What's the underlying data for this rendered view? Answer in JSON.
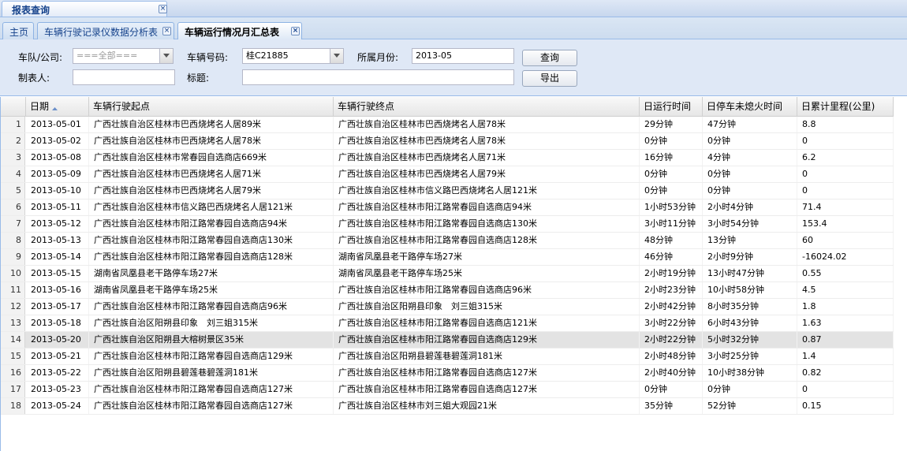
{
  "outer_tab": {
    "label": "报表查询"
  },
  "tabs": [
    {
      "label": "主页"
    },
    {
      "label": "车辆行驶记录仪数据分析表"
    },
    {
      "label": "车辆运行情况月汇总表"
    }
  ],
  "form": {
    "company_label": "车队/公司:",
    "company_value": "===全部===",
    "vehicle_label": "车辆号码:",
    "vehicle_value": "桂C21885",
    "month_label": "所属月份:",
    "month_value": "2013-05",
    "maker_label": "制表人:",
    "maker_value": "",
    "title_label": "标题:",
    "title_value": "",
    "query_button": "查询",
    "export_button": "导出"
  },
  "grid": {
    "columns": [
      "日期",
      "车辆行驶起点",
      "车辆行驶终点",
      "日运行时间",
      "日停车未熄火时间",
      "日累计里程(公里)"
    ],
    "rows": [
      {
        "n": "1",
        "date": "2013-05-01",
        "start": "广西壮族自治区桂林市巴西烧烤名人居89米",
        "end": "广西壮族自治区桂林市巴西烧烤名人居78米",
        "run": "29分钟",
        "idle": "47分钟",
        "km": "8.8"
      },
      {
        "n": "2",
        "date": "2013-05-02",
        "start": "广西壮族自治区桂林市巴西烧烤名人居78米",
        "end": "广西壮族自治区桂林市巴西烧烤名人居78米",
        "run": "0分钟",
        "idle": "0分钟",
        "km": "0"
      },
      {
        "n": "3",
        "date": "2013-05-08",
        "start": "广西壮族自治区桂林市常春园自选商店669米",
        "end": "广西壮族自治区桂林市巴西烧烤名人居71米",
        "run": "16分钟",
        "idle": "4分钟",
        "km": "6.2"
      },
      {
        "n": "4",
        "date": "2013-05-09",
        "start": "广西壮族自治区桂林市巴西烧烤名人居71米",
        "end": "广西壮族自治区桂林市巴西烧烤名人居79米",
        "run": "0分钟",
        "idle": "0分钟",
        "km": "0"
      },
      {
        "n": "5",
        "date": "2013-05-10",
        "start": "广西壮族自治区桂林市巴西烧烤名人居79米",
        "end": "广西壮族自治区桂林市信义路巴西烧烤名人居121米",
        "run": "0分钟",
        "idle": "0分钟",
        "km": "0"
      },
      {
        "n": "6",
        "date": "2013-05-11",
        "start": "广西壮族自治区桂林市信义路巴西烧烤名人居121米",
        "end": "广西壮族自治区桂林市阳江路常春园自选商店94米",
        "run": "1小时53分钟",
        "idle": "2小时4分钟",
        "km": "71.4"
      },
      {
        "n": "7",
        "date": "2013-05-12",
        "start": "广西壮族自治区桂林市阳江路常春园自选商店94米",
        "end": "广西壮族自治区桂林市阳江路常春园自选商店130米",
        "run": "3小时11分钟",
        "idle": "3小时54分钟",
        "km": "153.4"
      },
      {
        "n": "8",
        "date": "2013-05-13",
        "start": "广西壮族自治区桂林市阳江路常春园自选商店130米",
        "end": "广西壮族自治区桂林市阳江路常春园自选商店128米",
        "run": "48分钟",
        "idle": "13分钟",
        "km": "60"
      },
      {
        "n": "9",
        "date": "2013-05-14",
        "start": "广西壮族自治区桂林市阳江路常春园自选商店128米",
        "end": "湖南省凤凰县老干路停车场27米",
        "run": "46分钟",
        "idle": "2小时9分钟",
        "km": "-16024.02"
      },
      {
        "n": "10",
        "date": "2013-05-15",
        "start": "湖南省凤凰县老干路停车场27米",
        "end": "湖南省凤凰县老干路停车场25米",
        "run": "2小时19分钟",
        "idle": "13小时47分钟",
        "km": "0.55"
      },
      {
        "n": "11",
        "date": "2013-05-16",
        "start": "湖南省凤凰县老干路停车场25米",
        "end": "广西壮族自治区桂林市阳江路常春园自选商店96米",
        "run": "2小时23分钟",
        "idle": "10小时58分钟",
        "km": "4.5"
      },
      {
        "n": "12",
        "date": "2013-05-17",
        "start": "广西壮族自治区桂林市阳江路常春园自选商店96米",
        "end": "广西壮族自治区阳朔县印象　刘三姐315米",
        "run": "2小时42分钟",
        "idle": "8小时35分钟",
        "km": "1.8"
      },
      {
        "n": "13",
        "date": "2013-05-18",
        "start": "广西壮族自治区阳朔县印象　刘三姐315米",
        "end": "广西壮族自治区桂林市阳江路常春园自选商店121米",
        "run": "3小时22分钟",
        "idle": "6小时43分钟",
        "km": "1.63"
      },
      {
        "n": "14",
        "date": "2013-05-20",
        "start": "广西壮族自治区阳朔县大榕树景区35米",
        "end": "广西壮族自治区桂林市阳江路常春园自选商店129米",
        "run": "2小时22分钟",
        "idle": "5小时32分钟",
        "km": "0.87"
      },
      {
        "n": "15",
        "date": "2013-05-21",
        "start": "广西壮族自治区桂林市阳江路常春园自选商店129米",
        "end": "广西壮族自治区阳朔县碧莲巷碧莲洞181米",
        "run": "2小时48分钟",
        "idle": "3小时25分钟",
        "km": "1.4"
      },
      {
        "n": "16",
        "date": "2013-05-22",
        "start": "广西壮族自治区阳朔县碧莲巷碧莲洞181米",
        "end": "广西壮族自治区桂林市阳江路常春园自选商店127米",
        "run": "2小时40分钟",
        "idle": "10小时38分钟",
        "km": "0.82"
      },
      {
        "n": "17",
        "date": "2013-05-23",
        "start": "广西壮族自治区桂林市阳江路常春园自选商店127米",
        "end": "广西壮族自治区桂林市阳江路常春园自选商店127米",
        "run": "0分钟",
        "idle": "0分钟",
        "km": "0"
      },
      {
        "n": "18",
        "date": "2013-05-24",
        "start": "广西壮族自治区桂林市阳江路常春园自选商店127米",
        "end": "广西壮族自治区桂林市刘三姐大观园21米",
        "run": "35分钟",
        "idle": "52分钟",
        "km": "0.15"
      }
    ]
  }
}
